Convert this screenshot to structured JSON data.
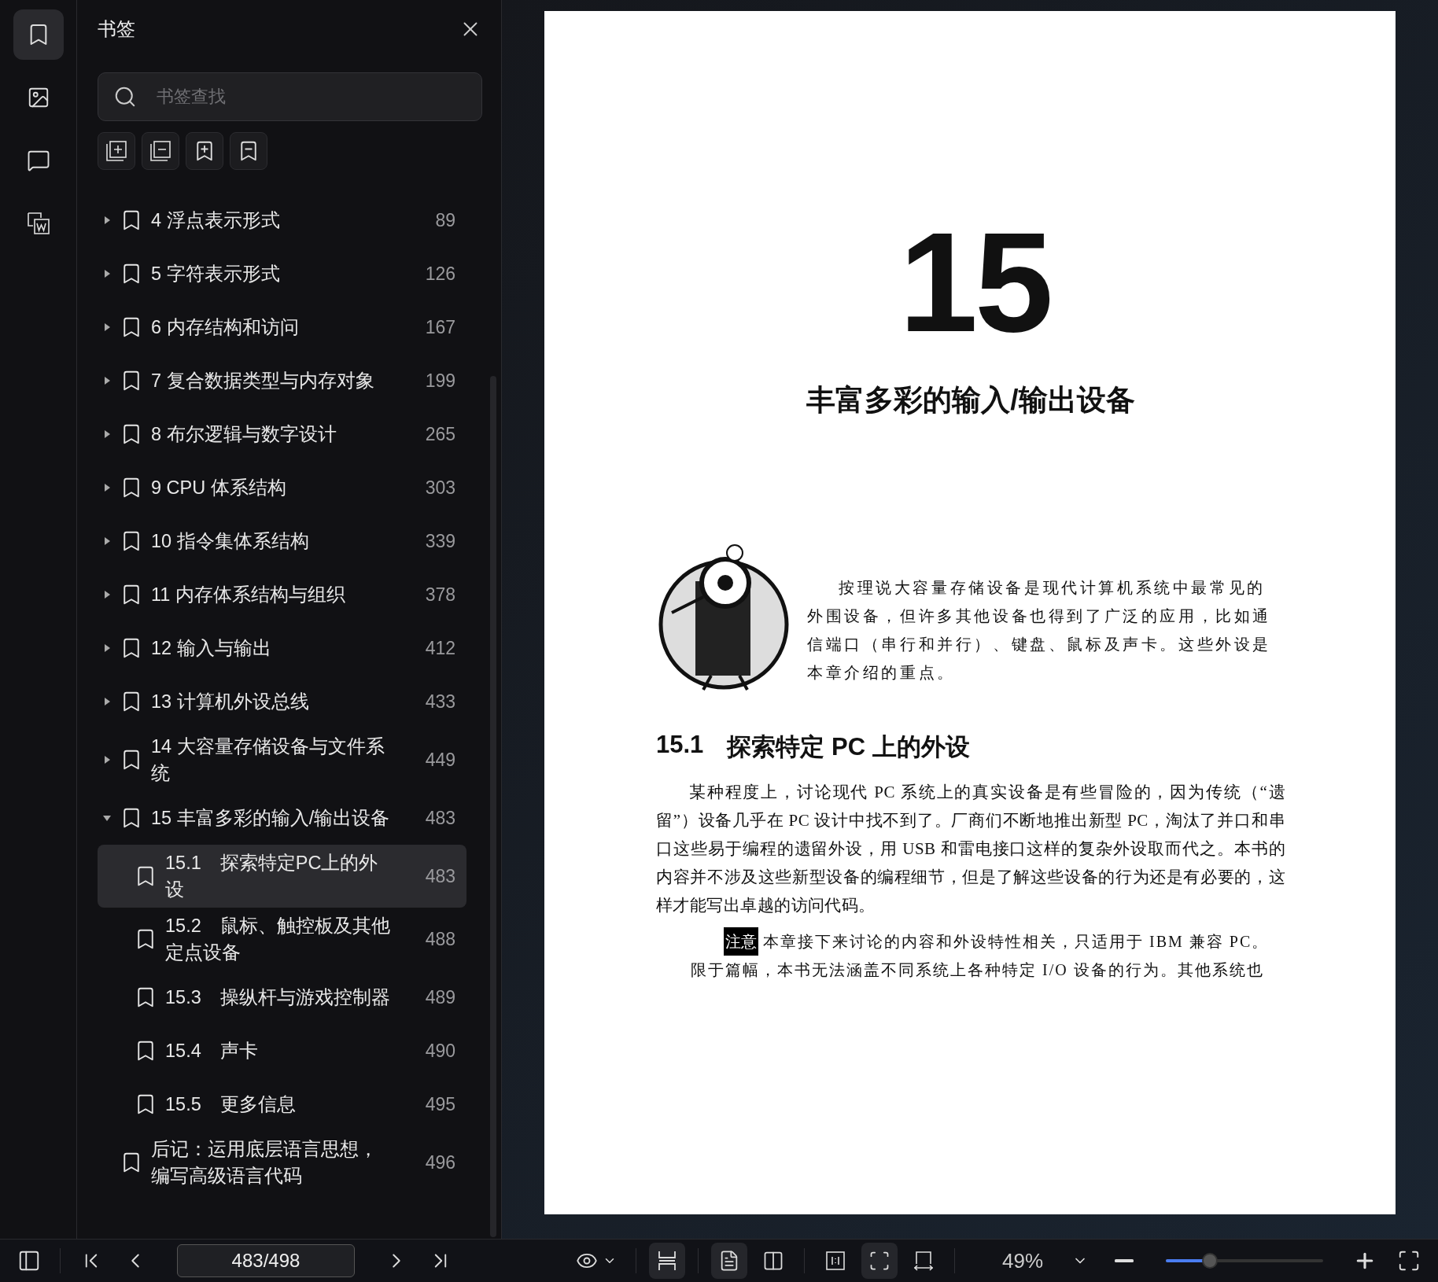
{
  "rail": [
    {
      "kind": "bookmark",
      "selected": true
    },
    {
      "kind": "image",
      "selected": false
    },
    {
      "kind": "comment",
      "selected": false
    },
    {
      "kind": "word",
      "selected": false
    }
  ],
  "panel": {
    "title": "书签",
    "search": {
      "placeholder": "书签查找"
    },
    "tools": [
      {
        "kind": "add-group"
      },
      {
        "kind": "remove-group"
      },
      {
        "kind": "add-bookmark"
      },
      {
        "kind": "remove-bookmark"
      }
    ]
  },
  "bookmarks": [
    {
      "kind": "folder",
      "label": "4 浮点表示形式",
      "page": "89",
      "expanded": false,
      "selected": false
    },
    {
      "kind": "folder",
      "label": "5 字符表示形式",
      "page": "126",
      "expanded": false,
      "selected": false
    },
    {
      "kind": "folder",
      "label": "6 内存结构和访问",
      "page": "167",
      "expanded": false,
      "selected": false
    },
    {
      "kind": "folder",
      "label": "7 复合数据类型与内存对象",
      "page": "199",
      "expanded": false,
      "selected": false
    },
    {
      "kind": "folder",
      "label": "8 布尔逻辑与数字设计",
      "page": "265",
      "expanded": false,
      "selected": false
    },
    {
      "kind": "folder",
      "label": "9 CPU 体系结构",
      "page": "303",
      "expanded": false,
      "selected": false
    },
    {
      "kind": "folder",
      "label": "10 指令集体系结构",
      "page": "339",
      "expanded": false,
      "selected": false
    },
    {
      "kind": "folder",
      "label": "11 内存体系结构与组织",
      "page": "378",
      "expanded": false,
      "selected": false
    },
    {
      "kind": "folder",
      "label": "12 输入与输出",
      "page": "412",
      "expanded": false,
      "selected": false
    },
    {
      "kind": "folder",
      "label": "13 计算机外设总线",
      "page": "433",
      "expanded": false,
      "selected": false
    },
    {
      "kind": "folder",
      "label": "14 大容量存储设备与文件系统",
      "page": "449",
      "expanded": false,
      "selected": false
    },
    {
      "kind": "folder",
      "label": "15 丰富多彩的输入/输出设备",
      "page": "483",
      "expanded": true,
      "selected": false,
      "children": [
        {
          "label": "15.1　探索特定PC上的外设",
          "page": "483",
          "selected": true
        },
        {
          "label": "15.2　鼠标、触控板及其他定点设备",
          "page": "488",
          "selected": false
        },
        {
          "label": "15.3　操纵杆与游戏控制器",
          "page": "489",
          "selected": false
        },
        {
          "label": "15.4　声卡",
          "page": "490",
          "selected": false
        },
        {
          "label": "15.5　更多信息",
          "page": "495",
          "selected": false
        }
      ]
    },
    {
      "kind": "leaf",
      "label": "后记：运用底层语言思想，编写高级语言代码",
      "page": "496",
      "selected": false
    }
  ],
  "document": {
    "chapter_number": "15",
    "chapter_title": "丰富多彩的输入/输出设备",
    "intro": "按理说大容量存储设备是现代计算机系统中最常见的外围设备，但许多其他设备也得到了广泛的应用，比如通信端口（串行和并行）、键盘、鼠标及声卡。这些外设是本章介绍的重点。",
    "section_number": "15.1",
    "section_title": "探索特定 PC 上的外设",
    "paragraph": "某种程度上，讨论现代 PC 系统上的真实设备是有些冒险的，因为传统（“遗留”）设备几乎在 PC 设计中找不到了。厂商们不断地推出新型 PC，淘汰了并口和串口这些易于编程的遗留外设，用 USB 和雷电接口这样的复杂外设取而代之。本书的内容并不涉及这些新型设备的编程细节，但是了解这些设备的行为还是有必要的，这样才能写出卓越的访问代码。",
    "note_label": "注意",
    "note_lines": [
      "本章接下来讨论的内容和外设特性相关，只适用于 IBM 兼容 PC。",
      "限于篇幅，本书无法涵盖不同系统上各种特定 I/O 设备的行为。其他系统也"
    ]
  },
  "toolbar": {
    "page_field": "483/498",
    "view_groups": [
      [
        {
          "kind": "read-mode",
          "selected": false
        }
      ],
      [
        {
          "kind": "fit-width",
          "selected": true
        }
      ],
      [
        {
          "kind": "single-page",
          "selected": true
        },
        {
          "kind": "two-pages",
          "selected": false
        }
      ],
      [
        {
          "kind": "actual-size",
          "selected": false
        },
        {
          "kind": "fit-page",
          "selected": true
        },
        {
          "kind": "fit-frame",
          "selected": false
        }
      ]
    ],
    "zoom": {
      "value": "49%",
      "level": 0.28
    }
  }
}
